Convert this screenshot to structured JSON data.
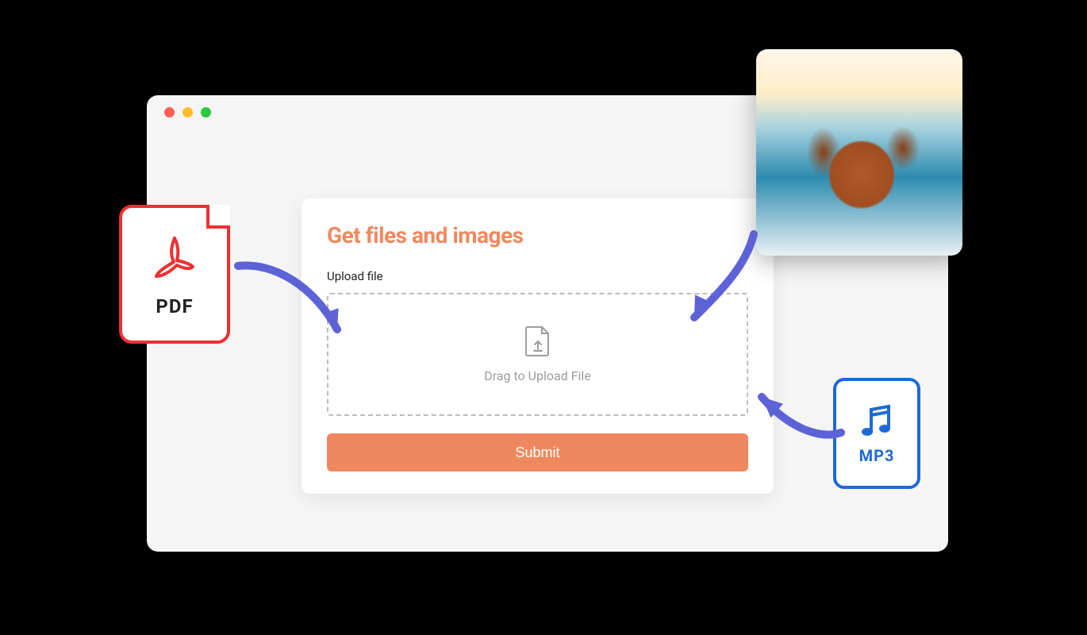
{
  "card": {
    "title": "Get files and images",
    "upload_label": "Upload file",
    "dropzone_text": "Drag to Upload File",
    "submit_label": "Submit"
  },
  "chips": {
    "pdf_label": "PDF",
    "mp3_label": "MP3"
  },
  "colors": {
    "accent": "#f0885f",
    "pdf": "#ef2f2f",
    "mp3": "#1d6ad6",
    "arrow": "#5d62d6"
  }
}
